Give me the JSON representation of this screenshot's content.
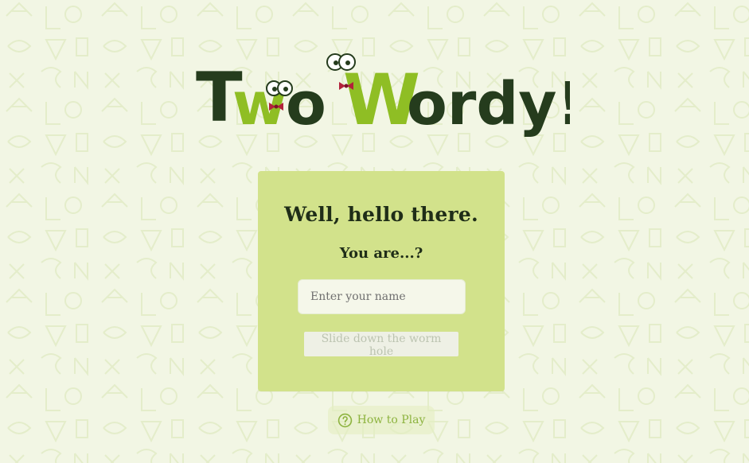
{
  "logo": {
    "part1": "T",
    "part2": "w",
    "part3": "o",
    "part4": "W",
    "part5": "ordy!"
  },
  "card": {
    "title": "Well, hello there.",
    "subtitle": "You are...?",
    "input_placeholder": "Enter your name",
    "button_label": "Slide down the worm hole"
  },
  "help": {
    "label": "How to Play",
    "icon": "question-circle-icon"
  },
  "colors": {
    "background": "#f2f6e4",
    "card": "#d2e28b",
    "text_dark": "#1f2d18",
    "accent": "#8db33f"
  }
}
